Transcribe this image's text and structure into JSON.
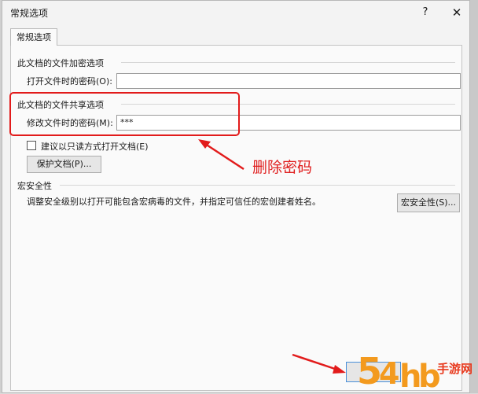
{
  "dialog": {
    "title": "常规选项",
    "help_glyph": "?",
    "close_glyph": "✕",
    "tab_label": "常规选项"
  },
  "encryption": {
    "group_title": "此文档的文件加密选项",
    "open_password_label": "打开文件时的密码(O):",
    "open_password_value": ""
  },
  "sharing": {
    "group_title": "此文档的文件共享选项",
    "modify_password_label": "修改文件时的密码(M):",
    "modify_password_value": "***",
    "readonly_label": "建议以只读方式打开文档(E)",
    "readonly_checked": false,
    "protect_button": "保护文档(P)..."
  },
  "macro": {
    "group_title": "宏安全性",
    "description": "调整安全级别以打开可能包含宏病毒的文件，并指定可信任的宏创建者姓名。",
    "button": "宏安全性(S)..."
  },
  "annotation": {
    "text": "删除密码",
    "color": "#e02020"
  },
  "watermark": {
    "text": "54hb手游网",
    "colors": {
      "orange": "#f39a1e",
      "red": "#e8391d"
    }
  }
}
